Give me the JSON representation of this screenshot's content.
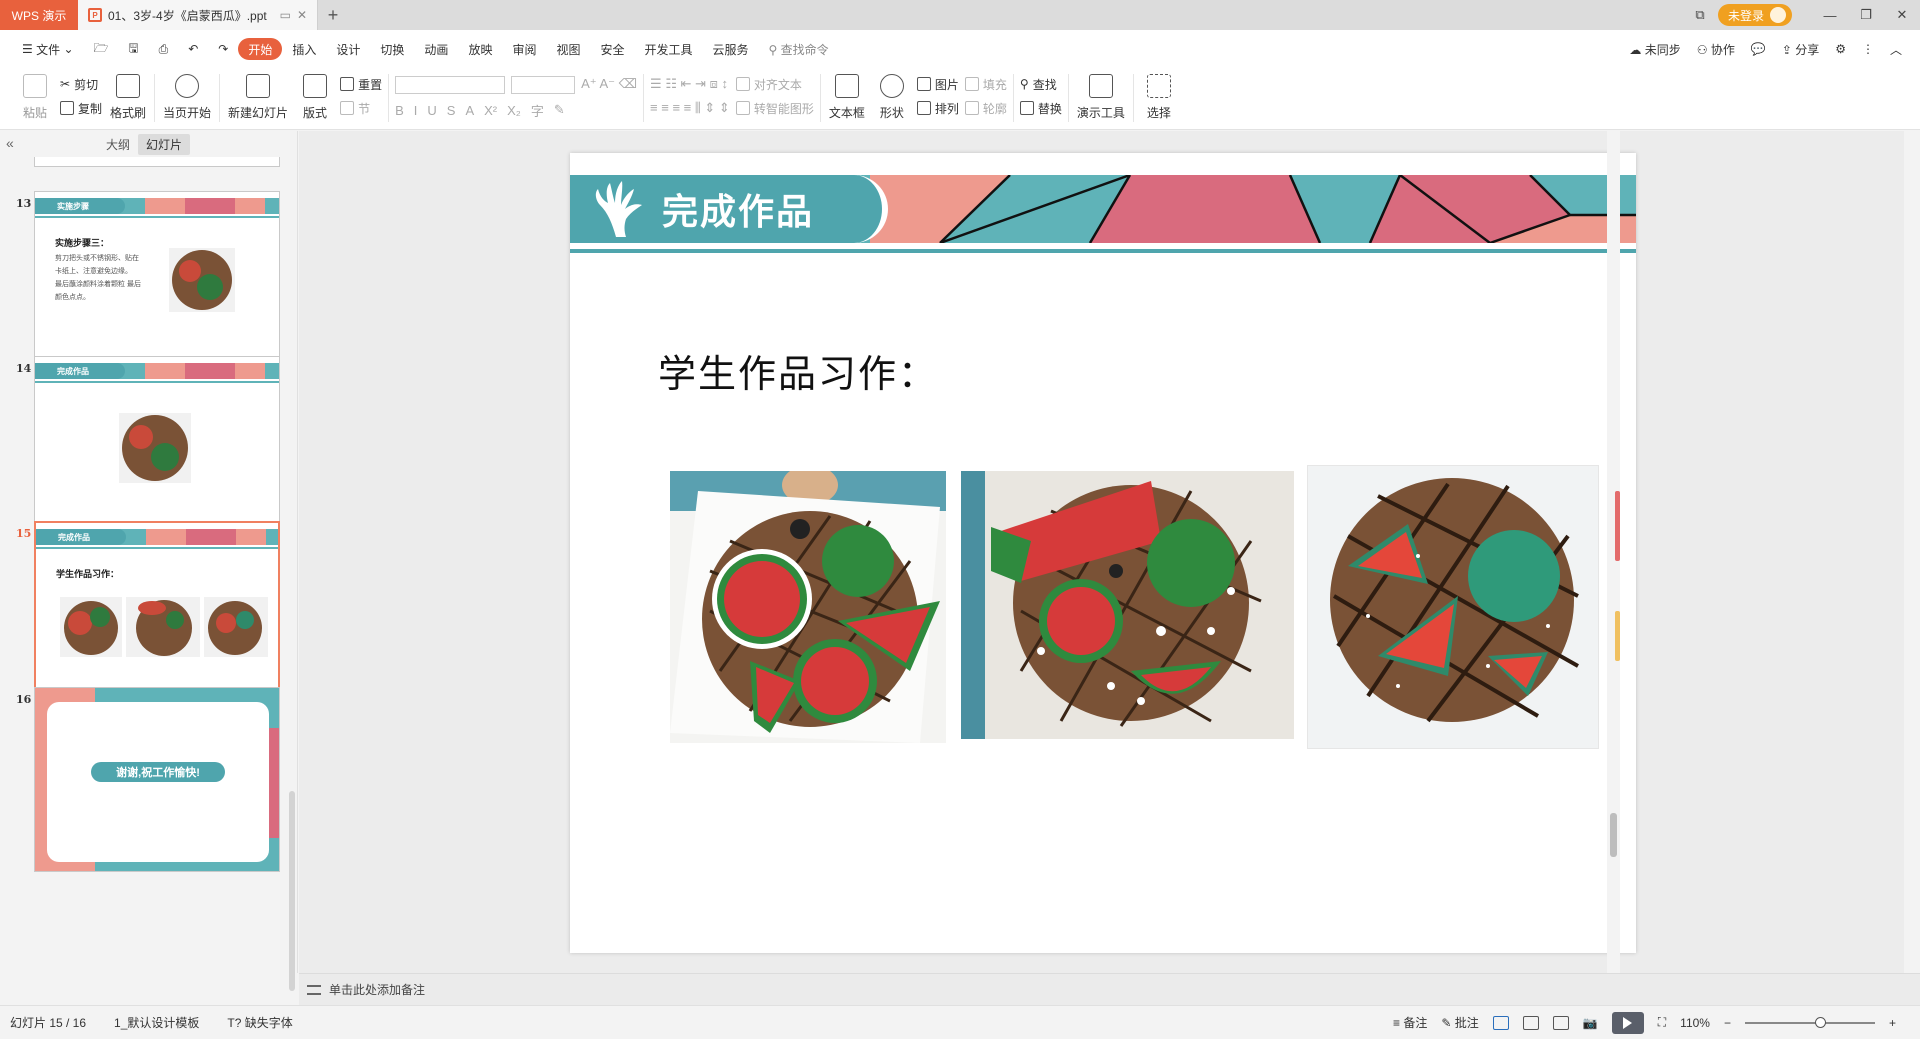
{
  "titlebar": {
    "app_name": "WPS 演示",
    "doc_tab": "01、3岁-4岁《启蒙西瓜》.ppt",
    "login": "未登录"
  },
  "menu": {
    "file": "文件",
    "tabs": [
      "开始",
      "插入",
      "设计",
      "切换",
      "动画",
      "放映",
      "审阅",
      "视图",
      "安全",
      "开发工具",
      "云服务"
    ],
    "active_tab": "开始",
    "search": "查找命令",
    "right": [
      "未同步",
      "协作",
      "分享"
    ]
  },
  "ribbon": {
    "paste": "粘贴",
    "cut": "剪切",
    "copy": "复制",
    "format_painter": "格式刷",
    "play_current": "当页开始",
    "new_slide": "新建幻灯片",
    "layout": "版式",
    "reset": "重置",
    "section": "节",
    "align_text": "对齐文本",
    "smart_art": "转智能图形",
    "textbox": "文本框",
    "shape": "形状",
    "picture": "图片",
    "arrange": "排列",
    "fill": "填充",
    "outline": "轮廓",
    "find": "查找",
    "replace": "替换",
    "presenter_tools": "演示工具",
    "select": "选择"
  },
  "panel": {
    "tab_outline": "大纲",
    "tab_slides": "幻灯片",
    "slides": [
      {
        "num": "13",
        "header": "实施步骤",
        "title": "实施步骤三：",
        "body": [
          "剪刀把头或不锈钢形、贴在",
          "卡纸上、注意避免边缘。",
          "最后蘸涂颜料涂着颗粒 最后",
          "颜色点点。"
        ]
      },
      {
        "num": "14",
        "header": "完成作品"
      },
      {
        "num": "15",
        "header": "完成作品",
        "title": "学生作品习作："
      },
      {
        "num": "16",
        "closing": "谢谢,祝工作愉快!"
      }
    ]
  },
  "slide": {
    "header": "完成作品",
    "heading": "学生作品习作："
  },
  "notes": {
    "placeholder": "单击此处添加备注"
  },
  "status": {
    "slide_counter": "幻灯片 15 / 16",
    "template": "1_默认设计模板",
    "missing_fonts": "缺失字体",
    "notes_btn": "备注",
    "comments_btn": "批注",
    "zoom": "110%"
  },
  "colors": {
    "accent": "#e8613d",
    "teal": "#4fa5ad",
    "pink": "#d96b7e",
    "salmon": "#ee9a8e"
  }
}
